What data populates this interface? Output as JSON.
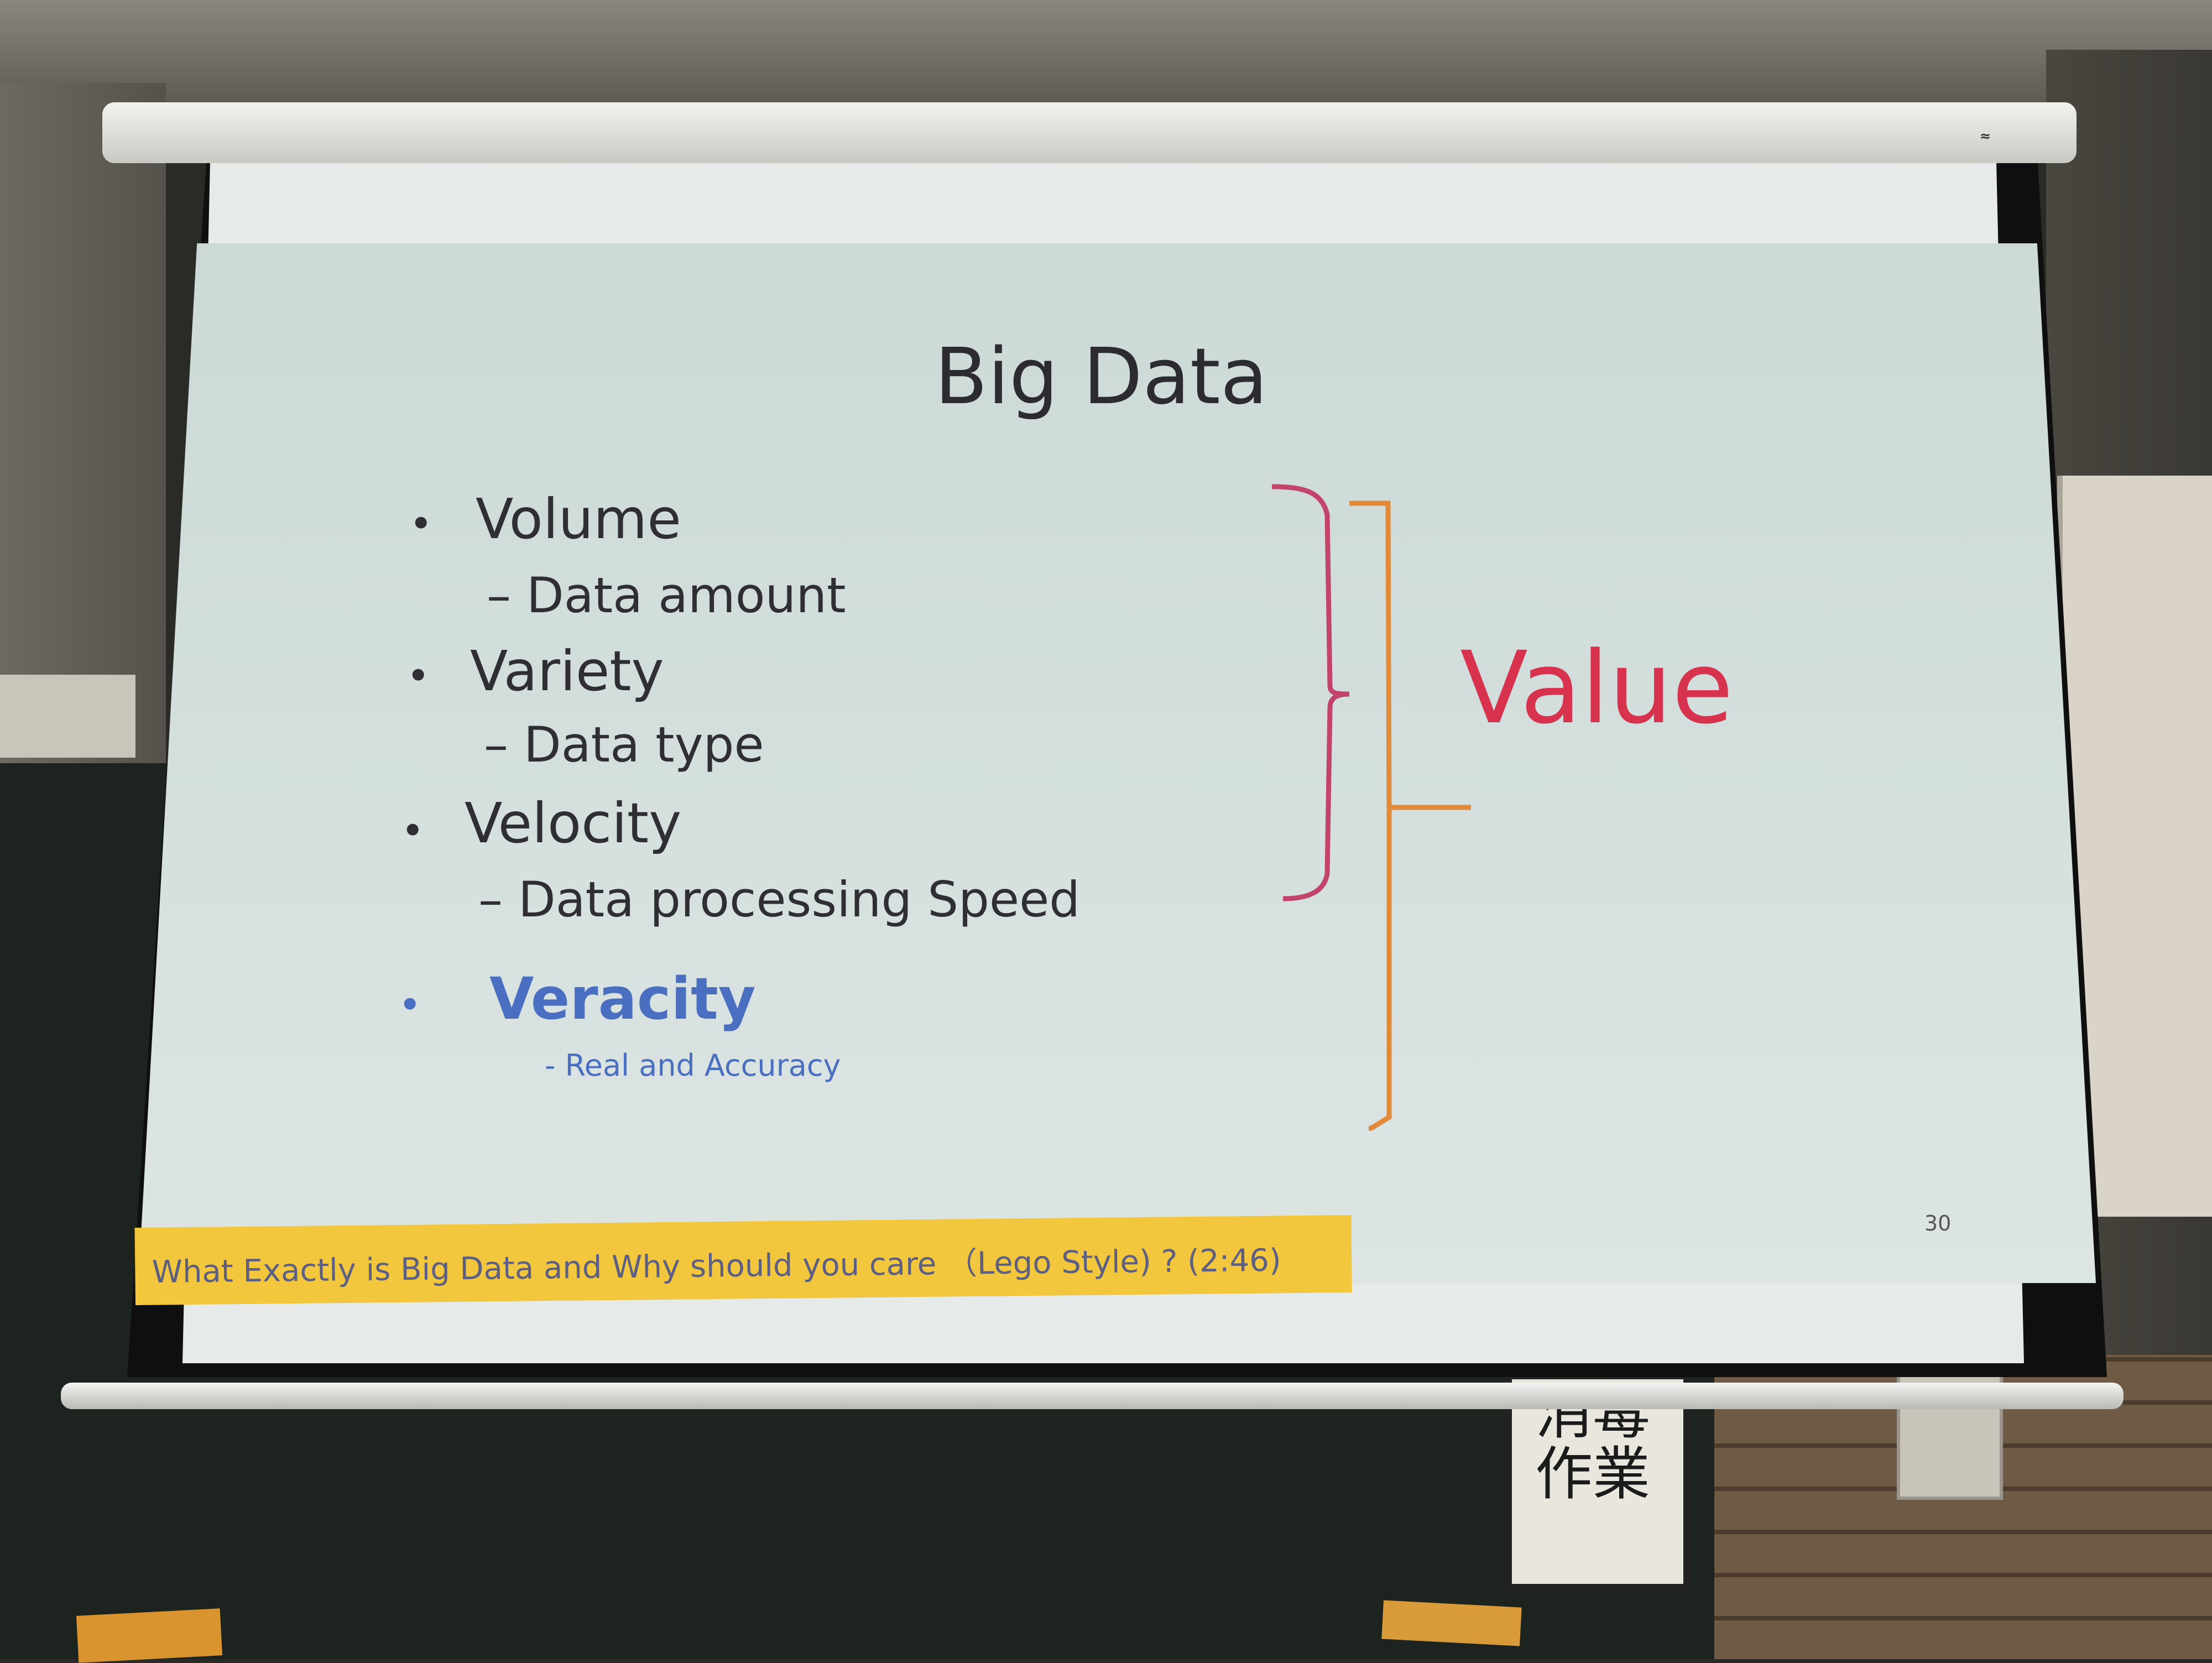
{
  "slide": {
    "title": "Big Data",
    "items": [
      {
        "bullet": "•",
        "label": "Volume",
        "sub": "– Data amount"
      },
      {
        "bullet": "•",
        "label": "Variety",
        "sub": "– Data type"
      },
      {
        "bullet": "•",
        "label": "Velocity",
        "sub": "– Data processing Speed"
      }
    ],
    "highlight_item": {
      "bullet": "•",
      "label": "Veracity",
      "sub": "- Real and Accuracy"
    },
    "value_label": "Value",
    "page_number": "30",
    "footer_link": "What Exactly is Big Data and Why should you care （Lego Style) ? (2:46)"
  },
  "colors": {
    "value_red": "#d8334e",
    "veracity_blue": "#4a6fc0",
    "brace_pink": "#c2446a",
    "brace_orange": "#e08a3a",
    "footer_yellow": "#f2c73d"
  },
  "room": {
    "poster_text": "消毒作業"
  }
}
